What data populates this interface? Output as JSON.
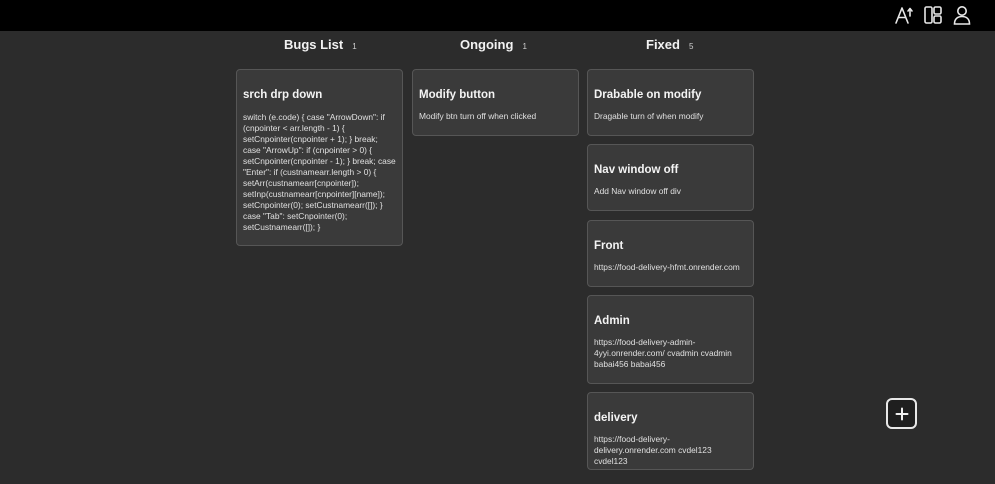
{
  "topbar": {
    "icons": [
      "font-size-icon",
      "layout-columns-icon",
      "user-icon"
    ]
  },
  "columns": [
    {
      "title": "Bugs List",
      "count": "1",
      "cards": [
        {
          "title": "srch drp down",
          "body": "switch (e.code) { case \"ArrowDown\": if (cnpointer < arr.length - 1) { setCnpointer(cnpointer + 1); } break; case \"ArrowUp\": if (cnpointer > 0) { setCnpointer(cnpointer - 1); } break; case \"Enter\": if (custnamearr.length > 0) { setArr(custnamearr[cnpointer]); setInp(custnamearr[cnpointer][name]); setCnpointer(0); setCustnamearr([]); } case \"Tab\": setCnpointer(0); setCustnamearr([]); }"
        }
      ]
    },
    {
      "title": "Ongoing",
      "count": "1",
      "cards": [
        {
          "title": "Modify button",
          "body": "Modify btn turn off when clicked"
        }
      ]
    },
    {
      "title": "Fixed",
      "count": "5",
      "cards": [
        {
          "title": "Drabable on modify",
          "body": "Dragable turn of when modify"
        },
        {
          "title": "Nav window off",
          "body": "Add Nav window off div"
        },
        {
          "title": "Front",
          "body": "https://food-delivery-hfmt.onrender.com"
        },
        {
          "title": "Admin",
          "body": "https://food-delivery-admin-4yyi.onrender.com/ cvadmin cvadmin babai456 babai456"
        },
        {
          "title": "delivery",
          "body": "https://food-delivery-delivery.onrender.com cvdel123 cvdel123"
        }
      ]
    }
  ],
  "add_button": {
    "icon": "plus-icon"
  }
}
